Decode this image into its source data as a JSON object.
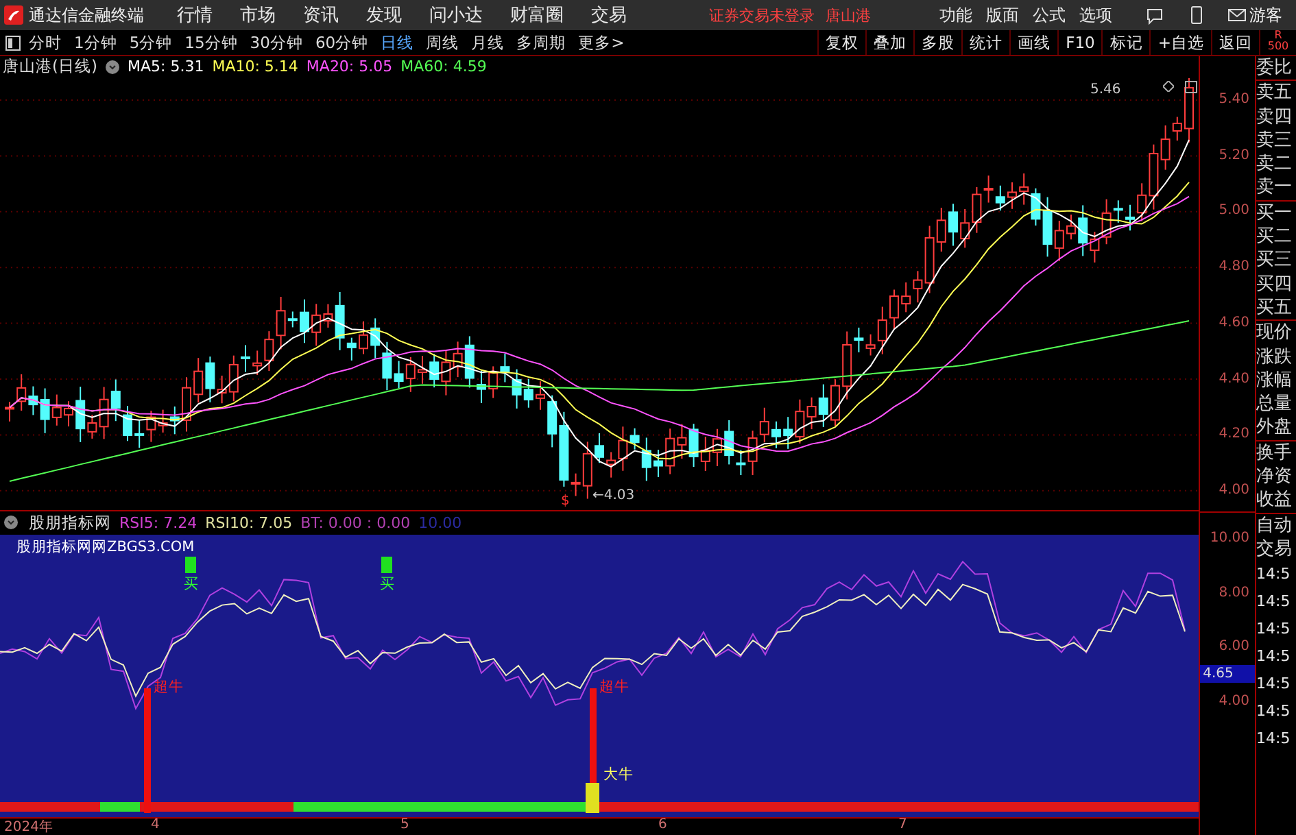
{
  "app": {
    "title": "通达信金融终端",
    "menu": [
      "行情",
      "市场",
      "资讯",
      "发现",
      "问小达",
      "财富圈",
      "交易"
    ],
    "notice": "证券交易未登录",
    "stock": "唐山港",
    "right_menu": [
      "功能",
      "版面",
      "公式",
      "选项"
    ],
    "user": "游客"
  },
  "toolbar": {
    "periods": [
      {
        "label": "分时",
        "selected": false
      },
      {
        "label": "1分钟",
        "selected": false
      },
      {
        "label": "5分钟",
        "selected": false
      },
      {
        "label": "15分钟",
        "selected": false
      },
      {
        "label": "30分钟",
        "selected": false
      },
      {
        "label": "60分钟",
        "selected": false
      },
      {
        "label": "日线",
        "selected": true
      },
      {
        "label": "周线",
        "selected": false
      },
      {
        "label": "月线",
        "selected": false
      },
      {
        "label": "多周期",
        "selected": false
      }
    ],
    "more": "更多>",
    "actions": [
      "复权",
      "叠加",
      "多股",
      "统计",
      "画线",
      "F10",
      "标记",
      "+自选",
      "返回"
    ],
    "corner": [
      "R",
      "500"
    ]
  },
  "price_chart": {
    "title": "唐山港(日线)",
    "indicators": [
      {
        "label": "MA5: 5.31",
        "color": "#ffffff"
      },
      {
        "label": "MA10: 5.14",
        "color": "#ffff54"
      },
      {
        "label": "MA20: 5.05",
        "color": "#ff54ff"
      },
      {
        "label": "MA60: 4.59",
        "color": "#54ff54"
      }
    ],
    "y_ticks": [
      "5.40",
      "5.20",
      "5.00",
      "4.80",
      "4.60",
      "4.40",
      "4.20",
      "4.00"
    ],
    "high_label": "5.46",
    "low_label": "←4.03",
    "marker": "$"
  },
  "indicator": {
    "name": "股朋指标网",
    "values": [
      {
        "label": "RSI5: 7.24",
        "color": "#d040d0"
      },
      {
        "label": "RSI10: 7.05",
        "color": "#e0e0a0"
      },
      {
        "label": "BT: 0.00 : 0.00",
        "color": "#b040b0"
      },
      {
        "label": "10.00",
        "color": "#2a2aa0"
      }
    ],
    "caption": "股朋指标网网ZBGS3.COM",
    "signals": [
      {
        "kind": "buy",
        "label": "买"
      },
      {
        "kind": "buy",
        "label": "买"
      },
      {
        "kind": "super",
        "label": "超牛"
      },
      {
        "kind": "super",
        "label": "超牛"
      },
      {
        "kind": "big",
        "label": "大牛"
      }
    ],
    "y_ticks": [
      "10.00",
      "8.00",
      "6.00",
      "4.00"
    ],
    "cursor_value": "4.65"
  },
  "x_axis": [
    "2024年",
    "4",
    "5",
    "6",
    "7"
  ],
  "quote_panel": [
    "委比",
    "卖五",
    "卖四",
    "卖三",
    "卖二",
    "卖一",
    "买一",
    "买二",
    "买三",
    "买四",
    "买五",
    "现价",
    "涨跌",
    "涨幅",
    "总量",
    "外盘",
    "换手",
    "净资",
    "收益",
    "自动",
    "交易"
  ],
  "trades": [
    "14:5",
    "14:5",
    "14:5",
    "14:5",
    "14:5",
    "14:5",
    "14:5"
  ]
}
